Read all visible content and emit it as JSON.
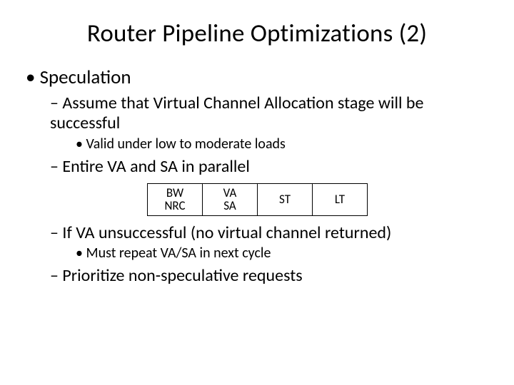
{
  "title": "Router Pipeline Optimizations (2)",
  "bullets": {
    "b1": "Speculation",
    "b1_1": "Assume that Virtual Channel Allocation stage will be successful",
    "b1_1_1": "Valid under low to moderate loads",
    "b1_2": "Entire VA and SA in parallel",
    "b1_3": "If VA unsuccessful (no virtual channel returned)",
    "b1_3_1": "Must repeat VA/SA in next cycle",
    "b1_4": "Prioritize non-speculative requests"
  },
  "pipeline": {
    "stage1_line1": "BW",
    "stage1_line2": "NRC",
    "stage2_line1": "VA",
    "stage2_line2": "SA",
    "stage3": "ST",
    "stage4": "LT"
  }
}
